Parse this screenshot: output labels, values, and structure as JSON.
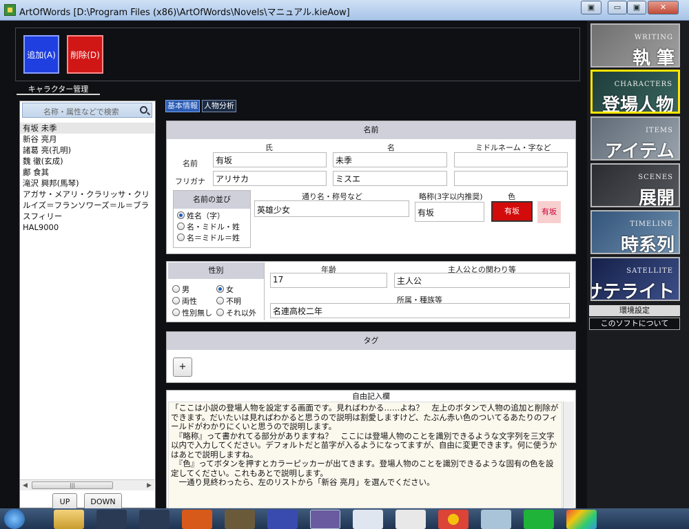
{
  "window": {
    "title": "ArtOfWords [D:\\Program Files (x86)\\ArtOfWords\\Novels\\マニュアル.kieAow]",
    "icons": {
      "minimize": "▭",
      "restore": "▣",
      "close": "✕"
    }
  },
  "toolbar": {
    "add_label": "追加(A)",
    "delete_label": "削除(D)"
  },
  "character_tab": "キャラクター管理",
  "search": {
    "placeholder": "名称・属性などで検索"
  },
  "characters": [
    "有坂 未季",
    "新谷 亮月",
    "諸葛 亮(孔明)",
    "魏 徹(玄成)",
    "鄺 食其",
    "滝沢 興邦(馬琴)",
    "アガサ・メアリ・クラリッサ・クリ",
    "ルイズ＝フランソワーズ＝ル＝ブラ",
    "スフィリー",
    "HAL9000"
  ],
  "scrollbar": {
    "left": "◀",
    "grip": "|||",
    "right": "▶"
  },
  "list_buttons": {
    "up": "UP",
    "down": "DOWN"
  },
  "subtabs": {
    "basic": "基本情報",
    "analysis": "人物分析"
  },
  "name": {
    "header": "名前",
    "col_last": "氏",
    "col_first": "名",
    "col_middle": "ミドルネーム・字など",
    "row_name": "名前",
    "row_kana": "フリガナ",
    "last": "有坂",
    "first": "未季",
    "middle": "",
    "kana_last": "アリサカ",
    "kana_first": "ミスエ",
    "kana_middle": ""
  },
  "order": {
    "header": "名前の並び",
    "options": [
      "姓名（字）",
      "名・ミドル・姓",
      "名＝ミドル＝姓"
    ],
    "selected": 0
  },
  "alias": {
    "label": "通り名・称号など",
    "value": "英雄少女"
  },
  "abbr": {
    "label": "略称(3字以内推奨)",
    "value": "有坂"
  },
  "color": {
    "label": "色",
    "button": "有坂",
    "preview": "有坂",
    "button_color": "#d40b0b",
    "preview_color": "#f7cfcf"
  },
  "gender": {
    "header": "性別",
    "options": [
      "男",
      "女",
      "両性",
      "不明",
      "性別無し",
      "それ以外"
    ],
    "selected": 1
  },
  "age": {
    "label": "年齢",
    "value": "17"
  },
  "relation": {
    "label": "主人公との関わり等",
    "value": "主人公"
  },
  "affiliation": {
    "label": "所属・種族等",
    "value": "名連高校二年"
  },
  "tags": {
    "header": "タグ",
    "add": "+"
  },
  "memo": {
    "header": "自由記入欄",
    "text": "「ここは小説の登場人物を設定する画面です。見ればわかる……よね？　左上のボタンで人物の追加と削除ができます。だいたいは見ればわかると思うので説明は割愛しますけど、たぶん赤い色のついてるあたりのフィールドがわかりにくいと思うので説明します。\n　『略称』って書かれてる部分がありますね？　ここには登場人物のことを識別できるような文字列を三文字以内で入力してください。デフォルトだと苗字が入るようになってますが、自由に変更できます。何に使うかはあとで説明しますね。\n　『色』ってボタンを押すとカラーピッカーが出てきます。登場人物のことを識別できるような固有の色を設定してください。これもあとで説明します。\n　一通り見終わったら、左のリストから「新谷 亮月」を選んでください。"
  },
  "nav": [
    {
      "en": "WRITING",
      "ja": "執 筆",
      "bg": "#8c8c8c",
      "active": false
    },
    {
      "en": "CHARACTERS",
      "ja": "登場人物",
      "bg": "#2c4f4a",
      "active": true
    },
    {
      "en": "ITEMS",
      "ja": "アイテム",
      "bg": "#7d8792",
      "active": false
    },
    {
      "en": "SCENES",
      "ja": "展開",
      "bg": "#3a3d42",
      "active": false
    },
    {
      "en": "TIMELINE",
      "ja": "時系列",
      "bg": "#4a6b8e",
      "active": false
    },
    {
      "en": "SATELLITE",
      "ja": "サテライト",
      "bg": "#2a3a66",
      "active": false
    }
  ],
  "settings": {
    "env": "環境設定",
    "about": "このソフトについて"
  },
  "taskbar": {
    "icons": [
      "start-orb-icon",
      "explorer-icon",
      "clipchamp-icon",
      "unity-icon",
      "office-icon",
      "sublime-icon",
      "tetris-icon",
      "artofwords-icon",
      "notepad-icon",
      "search-app-icon",
      "chrome-icon",
      "photo-app-icon",
      "line-icon",
      "windows-logo-icon"
    ]
  }
}
